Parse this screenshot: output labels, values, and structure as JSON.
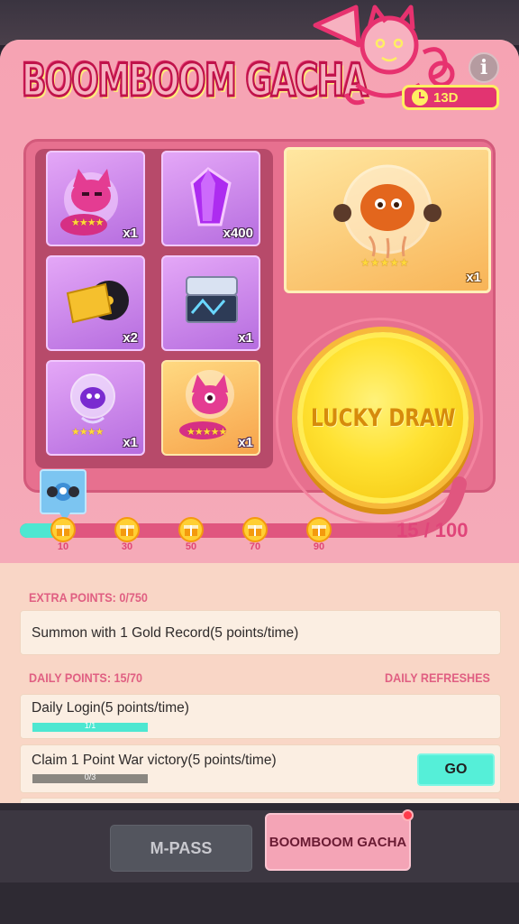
{
  "header": {
    "title": "BOOMBOOM GACHA",
    "info_label": "i",
    "timer": "13D"
  },
  "prizes": {
    "grid": [
      {
        "name": "pink cat pet",
        "qty": "x1",
        "stars": "★★★★",
        "style": "purple"
      },
      {
        "name": "purple gem",
        "qty": "x400",
        "stars": "",
        "style": "purple"
      },
      {
        "name": "gold record",
        "qty": "x2",
        "stars": "",
        "style": "purple"
      },
      {
        "name": "chest box",
        "qty": "x1",
        "stars": "",
        "style": "purple"
      },
      {
        "name": "purple octopus pet",
        "qty": "x1",
        "stars": "★★★★",
        "style": "purple"
      },
      {
        "name": "pink cat pet gold",
        "qty": "x1",
        "stars": "★★★★★",
        "style": "gold"
      }
    ],
    "featured": {
      "name": "orange octopus pet",
      "qty": "x1",
      "stars": "★★★★★"
    }
  },
  "lucky_draw": {
    "label": "LUCKY DRAW"
  },
  "progress": {
    "current": 15,
    "max": 100,
    "text": "15 / 100",
    "milestones": [
      "10",
      "30",
      "50",
      "70",
      "90"
    ]
  },
  "extra_points": {
    "heading": "EXTRA POINTS: 0/750",
    "tasks": [
      {
        "text": "Summon with 1 Gold Record(5 points/time)"
      }
    ]
  },
  "daily_points": {
    "heading": "DAILY POINTS: 15/70",
    "refresh_note": "DAILY REFRESHES",
    "tasks": [
      {
        "text": "Daily Login(5 points/time)",
        "progress": "1/1",
        "fraction": 1.0
      },
      {
        "text": "Claim 1 Point War victory(5 points/time)",
        "progress": "0/3",
        "fraction": 0.0,
        "action": "GO"
      }
    ]
  },
  "tabs": [
    {
      "label": "M-PASS",
      "active": false
    },
    {
      "label": "BOOMBOOM GACHA",
      "active": true
    }
  ],
  "colors": {
    "accent_pink": "#e23471",
    "teal": "#4de7d1",
    "gold": "#ffe232"
  }
}
